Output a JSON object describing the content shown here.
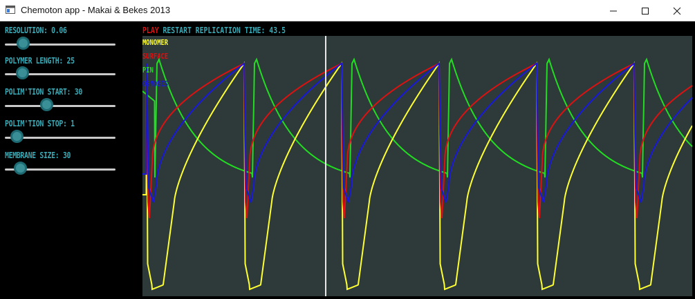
{
  "window": {
    "title": "Chemoton app - Makai & Bekes 2013",
    "minimize_icon": "minimize-icon",
    "maximize_icon": "maximize-icon",
    "close_icon": "close-icon"
  },
  "controls": [
    {
      "label": "RESOLUTION: 0.06",
      "value_fraction": 0.12
    },
    {
      "label": "POLYMER LENGTH: 25",
      "value_fraction": 0.11
    },
    {
      "label": "POLIM'TION START: 30",
      "value_fraction": 0.36
    },
    {
      "label": "POLIM'TION STOP: 1",
      "value_fraction": 0.06
    },
    {
      "label": "MEMBRANE SIZE: 30",
      "value_fraction": 0.09
    }
  ],
  "topbar": {
    "play_label": "PLAY",
    "restart_label": "RESTART",
    "replication_label": "REPLICATION TIME: 43.5"
  },
  "legend": [
    {
      "label": "MONOMER",
      "color": "#ffff33"
    },
    {
      "label": "SURFACE",
      "color": "#dd1111"
    },
    {
      "label": "PIN",
      "color": "#22dd22"
    },
    {
      "label": "OSMOSIS",
      "color": "#1818dd"
    }
  ],
  "colors": {
    "accent": "#3aa8b4",
    "play": "#dd1111",
    "plot_background": "#2d3a39",
    "cursor_line": "#e8e8e8"
  },
  "chart_data": {
    "type": "line",
    "period": 141,
    "cursor_x": 265,
    "series": [
      {
        "name": "MONOMER",
        "color": "#ffff33"
      },
      {
        "name": "SURFACE",
        "color": "#dd1111"
      },
      {
        "name": "PIN",
        "color": "#22dd22"
      },
      {
        "name": "OSMOSIS",
        "color": "#1818dd"
      }
    ]
  }
}
